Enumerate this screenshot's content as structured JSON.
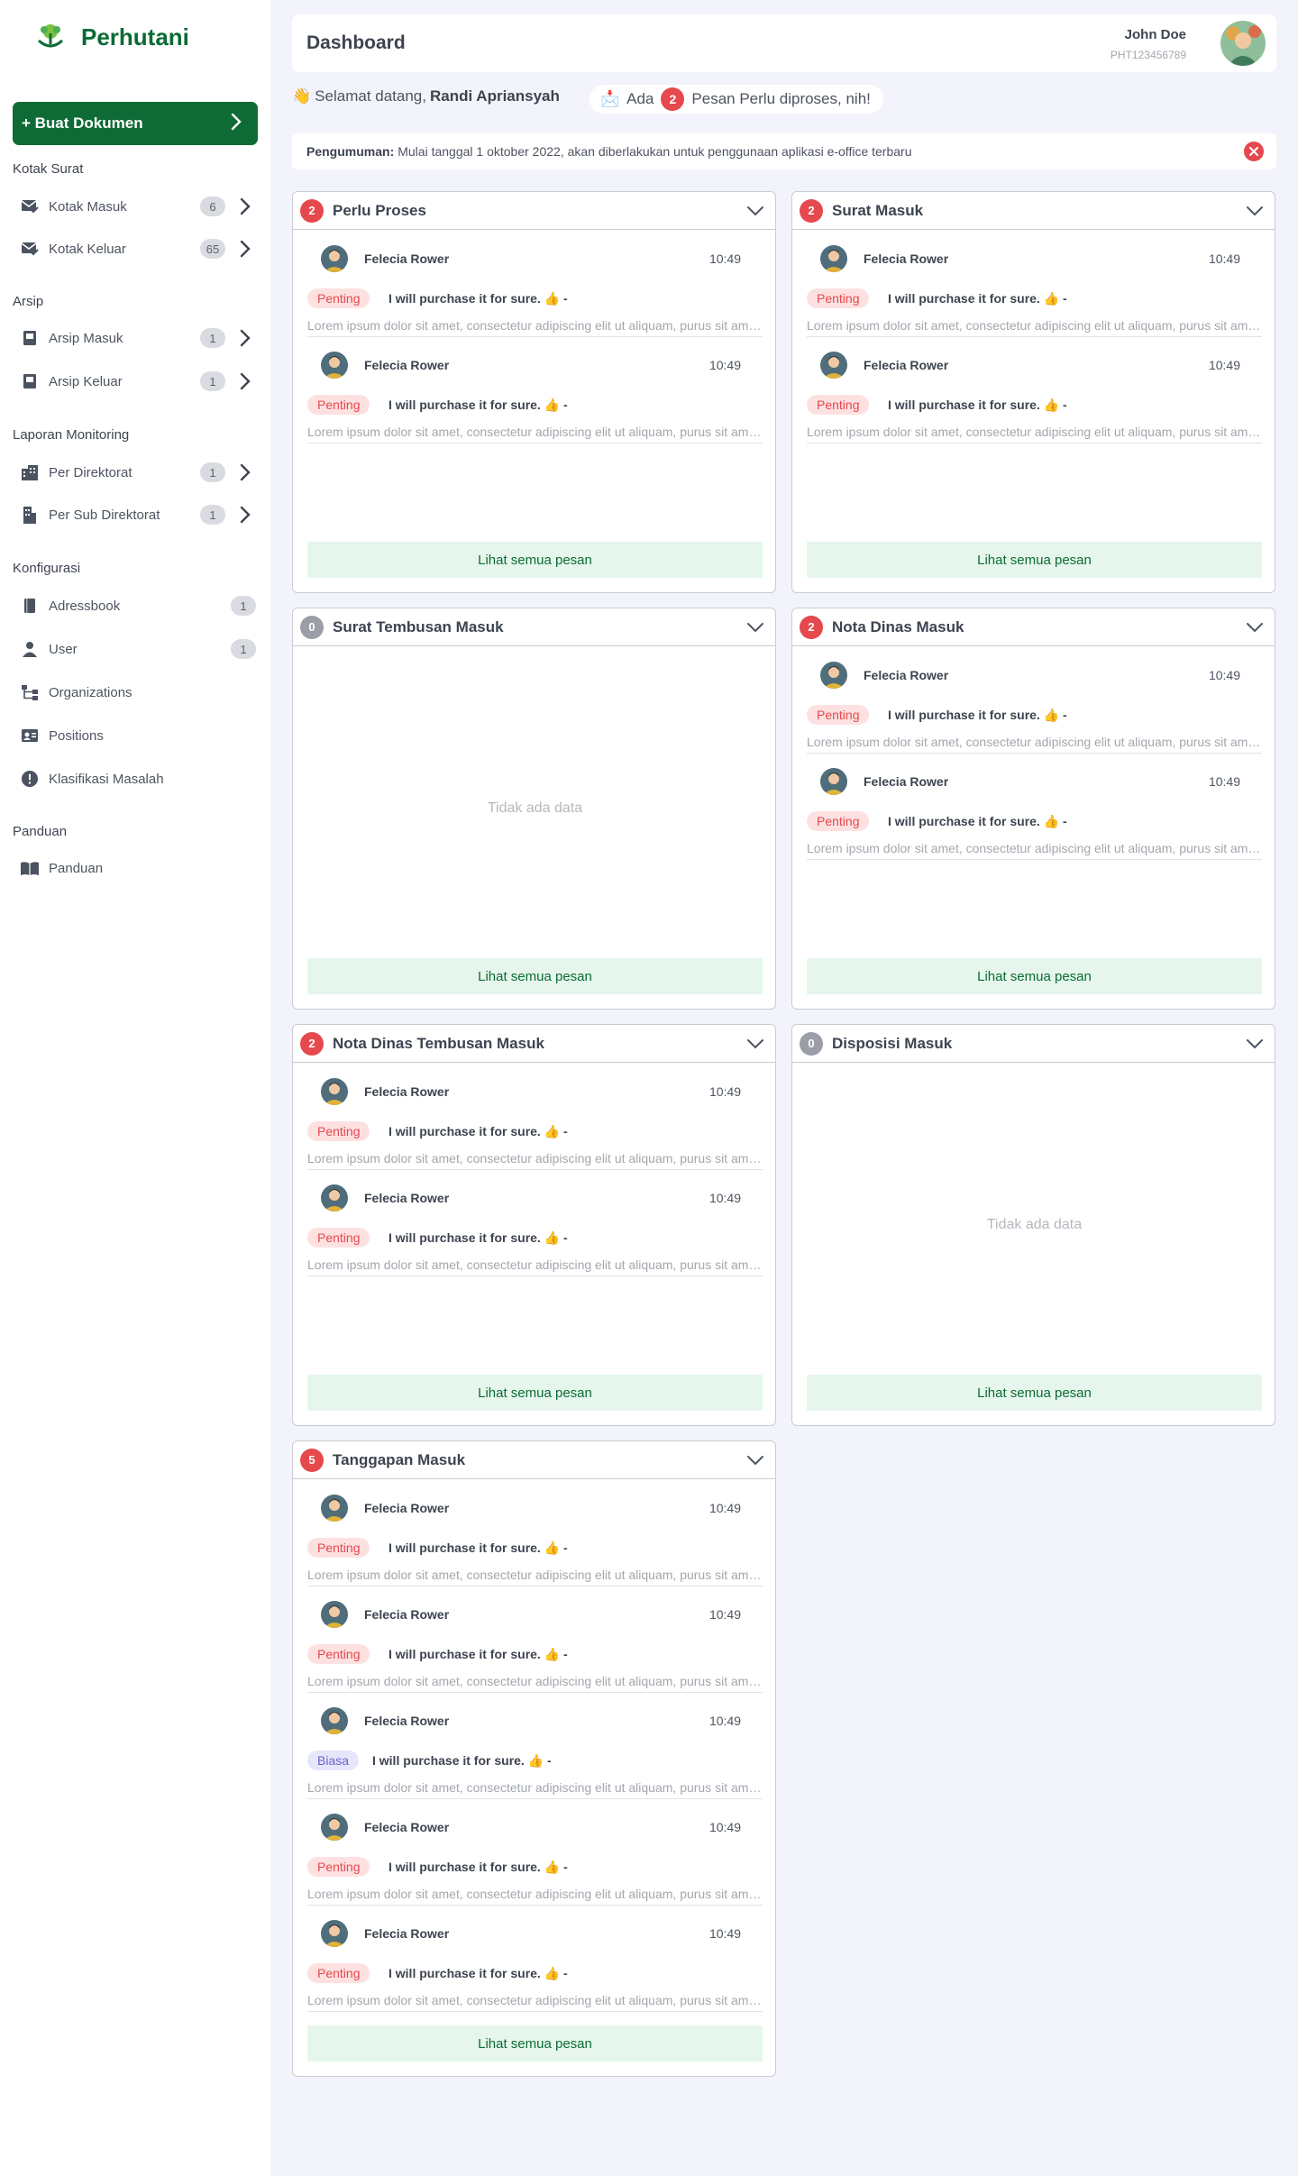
{
  "brand": {
    "name": "Perhutani",
    "color": "#0c6b35"
  },
  "create_button": {
    "label": "+ Buat Dokumen"
  },
  "sidebar": {
    "kotak_surat": {
      "label": "Kotak Surat",
      "items": [
        {
          "label": "Kotak Masuk",
          "badge": "6",
          "icon": "mail-inbox-icon"
        },
        {
          "label": "Kotak Keluar",
          "badge": "65",
          "icon": "mail-outbox-icon"
        }
      ]
    },
    "arsip": {
      "label": "Arsip",
      "items": [
        {
          "label": "Arsip Masuk",
          "badge": "1",
          "icon": "archive-in-icon"
        },
        {
          "label": "Arsip Keluar",
          "badge": "1",
          "icon": "archive-out-icon"
        }
      ]
    },
    "laporan": {
      "label": "Laporan Monitoring",
      "items": [
        {
          "label": "Per Direktorat",
          "badge": "1",
          "icon": "building-icon"
        },
        {
          "label": "Per Sub Direktorat",
          "badge": "1",
          "icon": "sub-building-icon"
        }
      ]
    },
    "konfigurasi": {
      "label": "Konfigurasi",
      "items": [
        {
          "label": "Adressbook",
          "badge": "1",
          "icon": "book-icon"
        },
        {
          "label": "User",
          "badge": "1",
          "icon": "user-icon"
        },
        {
          "label": "Organizations",
          "icon": "org-chart-icon"
        },
        {
          "label": "Positions",
          "icon": "id-card-icon"
        },
        {
          "label": "Klasifikasi Masalah",
          "icon": "alert-circle-icon"
        }
      ]
    },
    "panduan": {
      "label": "Panduan",
      "items": [
        {
          "label": "Panduan",
          "icon": "open-book-icon"
        }
      ]
    }
  },
  "header": {
    "title": "Dashboard",
    "user_name": "John Doe",
    "user_id": "PHT123456789"
  },
  "welcome": {
    "emoji": "👋",
    "prefix": "Selamat datang,",
    "name": "Randi Apriansyah"
  },
  "notice": {
    "emoji": "📩",
    "prefix": "Ada",
    "count": "2",
    "suffix": "Pesan Perlu diproses, nih!"
  },
  "announcement": {
    "label": "Pengumuman:",
    "text": "Mulai tanggal 1 oktober 2022, akan diberlakukan untuk penggunaan aplikasi e-office terbaru"
  },
  "see_all_label": "Lihat semua pesan",
  "empty_label": "Tidak ada data",
  "message_template": {
    "sender": "Felecia Rower",
    "time": "10:49",
    "subject": "I will purchase it for sure. 👍 -",
    "preview": "Lorem ipsum dolor sit amet, consectetur adipiscing elit ut aliquam, purus sit amet luctus venenatis"
  },
  "panels": [
    {
      "title": "Perlu Proses",
      "count": "2",
      "messages": [
        {
          "tag": "Penting"
        },
        {
          "tag": "Penting"
        }
      ]
    },
    {
      "title": "Surat Masuk",
      "count": "2",
      "messages": [
        {
          "tag": "Penting"
        },
        {
          "tag": "Penting"
        }
      ]
    },
    {
      "title": "Surat Tembusan Masuk",
      "count": "0",
      "messages": []
    },
    {
      "title": "Nota Dinas Masuk",
      "count": "2",
      "messages": [
        {
          "tag": "Penting"
        },
        {
          "tag": "Penting"
        }
      ]
    },
    {
      "title": "Nota Dinas Tembusan Masuk",
      "count": "2",
      "messages": [
        {
          "tag": "Penting"
        },
        {
          "tag": "Penting"
        }
      ]
    },
    {
      "title": "Disposisi Masuk",
      "count": "0",
      "messages": []
    },
    {
      "title": "Tanggapan Masuk",
      "count": "5",
      "messages": [
        {
          "tag": "Penting"
        },
        {
          "tag": "Penting"
        },
        {
          "tag": "Biasa"
        },
        {
          "tag": "Penting"
        },
        {
          "tag": "Penting"
        }
      ]
    }
  ],
  "colors": {
    "accent": "#0f6b36",
    "danger": "#e5484d",
    "background": "#f3f4fb"
  }
}
